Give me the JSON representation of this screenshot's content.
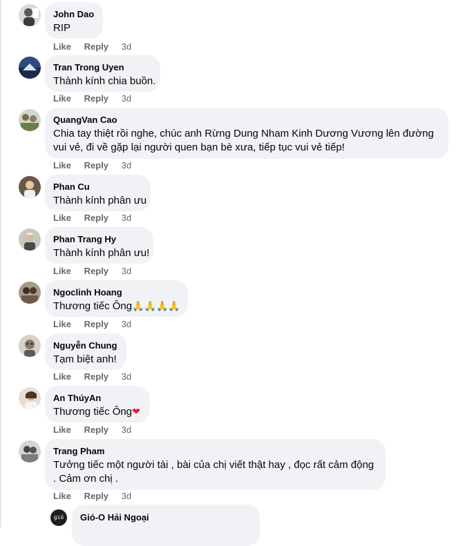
{
  "actions": {
    "like": "Like",
    "reply": "Reply"
  },
  "comments": [
    {
      "author": "John Dao",
      "text": "RIP",
      "time": "3d"
    },
    {
      "author": "Tran Trong Uyen",
      "text": "Thành kính chia buồn.",
      "time": "3d"
    },
    {
      "author": "QuangVan Cao",
      "text": "Chia tay thiệt rồi nghe, chúc anh Rừng Dung Nham Kinh Dương Vương lên đường vui vẻ, đi về gặp lại người quen bạn bè xưa, tiếp tục vui vẻ tiếp!",
      "time": "3d"
    },
    {
      "author": "Phan Cu",
      "text": "Thành kính phân ưu",
      "time": "3d"
    },
    {
      "author": "Phan Trang Hy",
      "text": "Thành kính phân ưu!",
      "time": "3d"
    },
    {
      "author": "Ngoclinh Hoang",
      "text": "Thương tiếc Ông",
      "emoji": "🙏🙏🙏🙏",
      "time": "3d"
    },
    {
      "author": "Nguyễn Chung",
      "text": "Tạm biệt anh!",
      "time": "3d"
    },
    {
      "author": "An ThúyAn",
      "text": "Thương tiếc Ông",
      "emoji": "❤",
      "time": "3d"
    },
    {
      "author": "Trang Pham",
      "text": "Tưởng tiếc một người tài , bài của chị viết thật hay , đọc rất cảm động . Cảm ơn chị .",
      "time": "3d"
    }
  ],
  "reply": {
    "author": "Gió-O Hải Ngoại",
    "avatar_text": "gió"
  },
  "colors": {
    "bubble": "#f0f2f5",
    "meta": "#65676b",
    "text": "#050505"
  }
}
